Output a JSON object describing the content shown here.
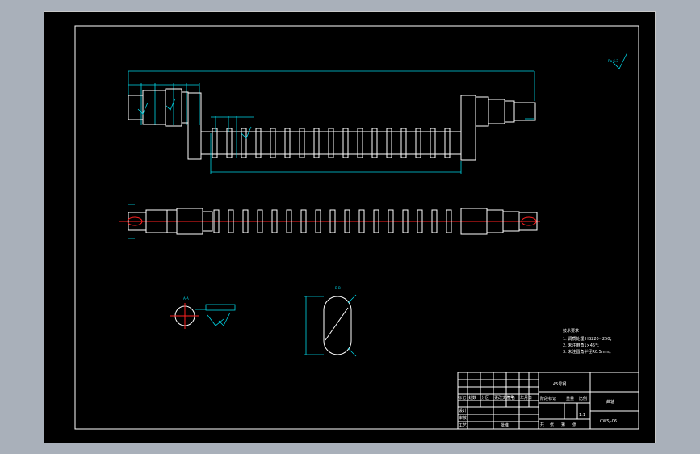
{
  "colors": {
    "background": "#a9b0ba",
    "sheet": "#000000",
    "outline": "#ffffff",
    "dimension": "#00d7e8",
    "centerline": "#ff2020"
  },
  "drawing": {
    "section_labels": {
      "a": "A-A",
      "b": "B-B"
    },
    "roughness_symbol": "Ra 6.3",
    "tech_requirements": {
      "heading": "技术要求",
      "items": [
        "1. 调质处理 HB220~250；",
        "2. 未注倒角1×45°；",
        "3. 未注圆角半径R0.5mm。"
      ]
    },
    "title_block": {
      "material": "45号钢",
      "part_name": "曲轴",
      "drawing_number": "CWSJ-06",
      "scale": "1:1",
      "header_cells": [
        "标记",
        "处数",
        "分区",
        "更改文件号",
        "签名",
        "年月日"
      ],
      "stage_label": "阶段标记",
      "weight_label": "重量",
      "scale_label": "比例",
      "left_rows": [
        "设计",
        "审核",
        "工艺"
      ],
      "approval_label": "批准",
      "bottom_cells": [
        "共",
        "张",
        "第",
        "张"
      ]
    }
  }
}
